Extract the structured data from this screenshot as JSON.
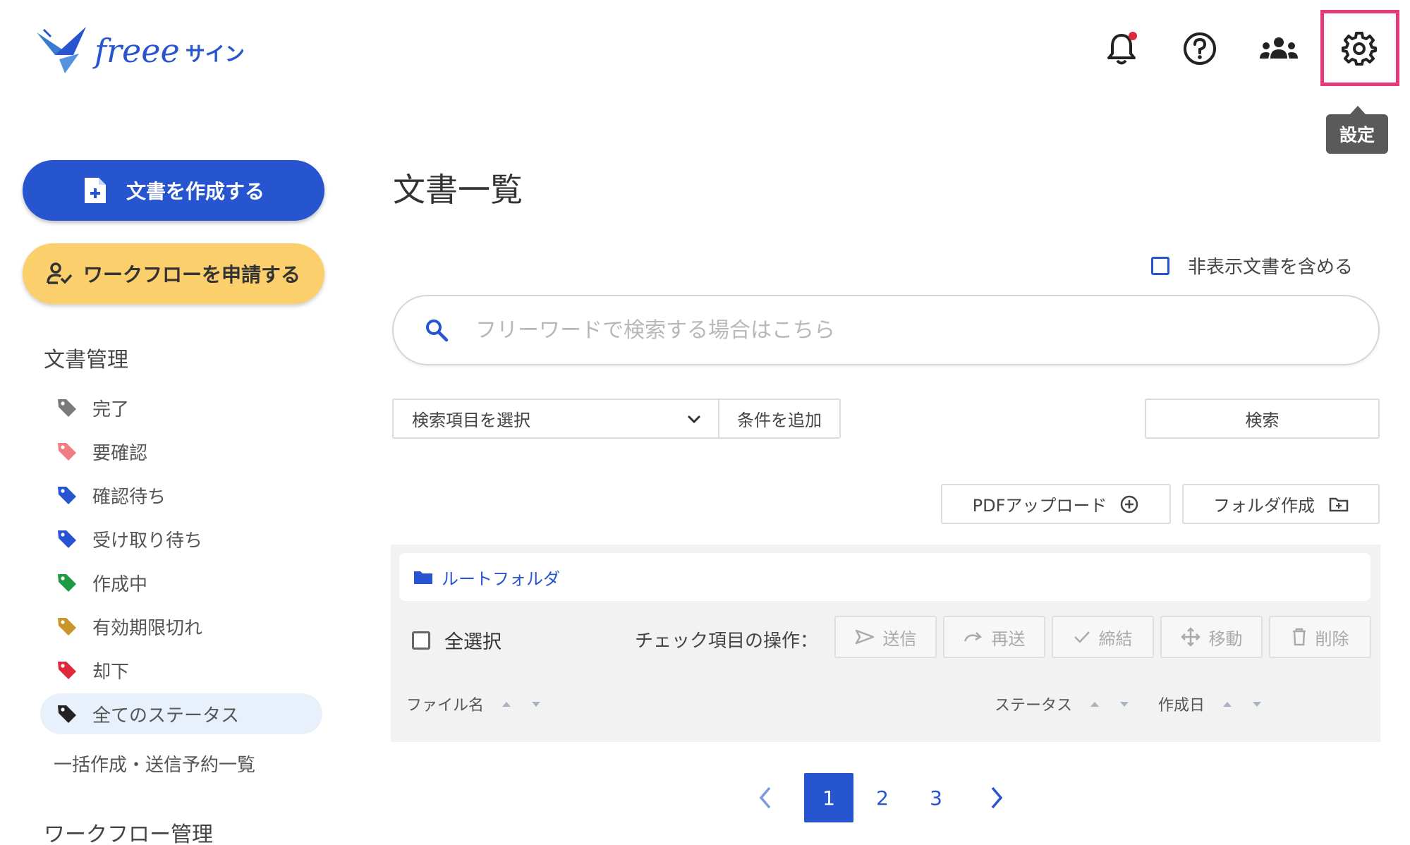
{
  "header": {
    "logo_brand": "freee",
    "logo_product": "サイン",
    "tooltip": "設定"
  },
  "sidebar": {
    "create_button": "文書を作成する",
    "workflow_button": "ワークフローを申請する",
    "doc_section_title": "文書管理",
    "status_items": [
      {
        "label": "完了",
        "color": "#7a7a7a"
      },
      {
        "label": "要確認",
        "color": "#f07c84"
      },
      {
        "label": "確認待ち",
        "color": "#2755cf"
      },
      {
        "label": "受け取り待ち",
        "color": "#2755cf"
      },
      {
        "label": "作成中",
        "color": "#1e9a45"
      },
      {
        "label": "有効期限切れ",
        "color": "#c9962a"
      },
      {
        "label": "却下",
        "color": "#e0283c"
      },
      {
        "label": "全てのステータス",
        "color": "#222222"
      }
    ],
    "bulk_link": "一括作成・送信予約一覧",
    "workflow_section_title": "ワークフロー管理"
  },
  "main": {
    "title": "文書一覧",
    "include_hidden": "非表示文書を含める",
    "search_placeholder": "フリーワードで検索する場合はこちら",
    "select_label": "検索項目を選択",
    "add_condition": "条件を追加",
    "search_button": "検索",
    "pdf_upload": "PDFアップロード",
    "create_folder": "フォルダ作成",
    "root_folder": "ルートフォルダ",
    "select_all": "全選択",
    "check_ops_label": "チェック項目の操作：",
    "ops": {
      "send": "送信",
      "resend": "再送",
      "conclude": "締結",
      "move": "移動",
      "delete": "削除"
    },
    "columns": {
      "file_name": "ファイル名",
      "status": "ステータス",
      "created": "作成日"
    },
    "pagination": {
      "pages": [
        "1",
        "2",
        "3"
      ],
      "current": "1"
    }
  },
  "colors": {
    "primary": "#2755cf",
    "workflow": "#fbcf6b",
    "highlight": "#e83a7a"
  }
}
